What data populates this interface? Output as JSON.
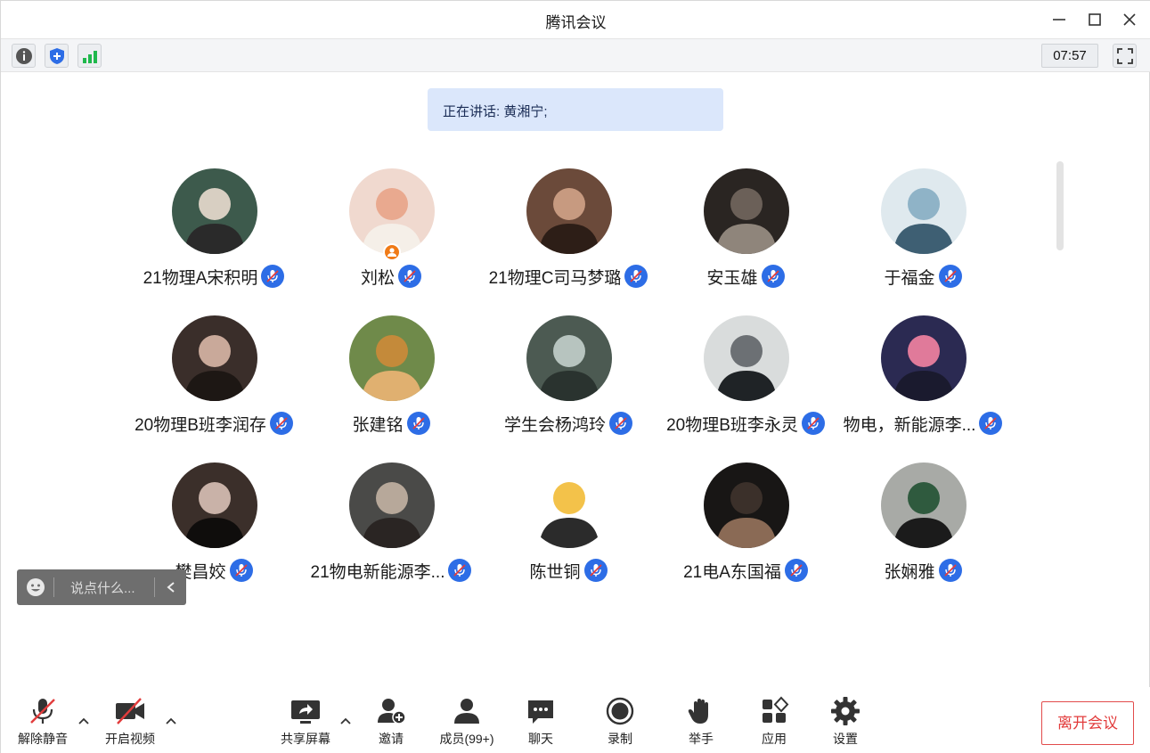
{
  "window": {
    "title": "腾讯会议"
  },
  "toolbar": {
    "timer": "07:57"
  },
  "speaking": {
    "text": "正在讲话: 黄湘宁;"
  },
  "participants": [
    {
      "name": "21物理A宋积明"
    },
    {
      "name": "刘松",
      "host": true
    },
    {
      "name": "21物理C司马梦璐"
    },
    {
      "name": "安玉雄"
    },
    {
      "name": "于福金"
    },
    {
      "name": "20物理B班李润存"
    },
    {
      "name": "张建铭"
    },
    {
      "name": "学生会杨鸿玲"
    },
    {
      "name": "20物理B班李永灵"
    },
    {
      "name": "物电，新能源李..."
    },
    {
      "name": "樊昌姣"
    },
    {
      "name": "21物电新能源李..."
    },
    {
      "name": "陈世铜"
    },
    {
      "name": "21电A东国福"
    },
    {
      "name": "张娴雅"
    }
  ],
  "chat": {
    "placeholder": "说点什么..."
  },
  "bottombar": {
    "unmute": "解除静音",
    "video": "开启视频",
    "share": "共享屏幕",
    "invite": "邀请",
    "members": "成员(99+)",
    "chat": "聊天",
    "record": "录制",
    "raise_hand": "举手",
    "apps": "应用",
    "settings": "设置",
    "leave": "离开会议"
  },
  "colors": {
    "accent": "#2d6de6",
    "leave": "#e23c3c",
    "speaking_bg": "#dbe7fb",
    "host_badge": "#f07a16"
  },
  "icons": {
    "mic": "mic-muted-icon",
    "host": "host-icon"
  }
}
